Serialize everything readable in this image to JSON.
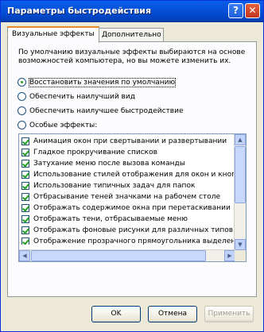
{
  "window": {
    "title": "Параметры быстродействия",
    "help_label": "?",
    "close_label": "✕"
  },
  "tabs": [
    {
      "label": "Визуальные эффекты"
    },
    {
      "label": "Дополнительно"
    }
  ],
  "panel": {
    "description": "По умолчанию визуальные эффекты выбираются на основе возможностей компьютера, но вы можете изменить их.",
    "radios": [
      {
        "label": "Восстановить значения по умолчанию",
        "selected": true
      },
      {
        "label": "Обеспечить наилучший вид",
        "selected": false
      },
      {
        "label": "Обеспечить наилучшее быстродействие",
        "selected": false
      },
      {
        "label": "Особые эффекты:",
        "selected": false
      }
    ],
    "effects": [
      {
        "label": "Анимация окон при свертывании и развертывании",
        "checked": true
      },
      {
        "label": "Гладкое прокручивание списков",
        "checked": true
      },
      {
        "label": "Затухание меню после вызова команды",
        "checked": true
      },
      {
        "label": "Использование стилей отображения для окон и кнопок",
        "checked": true
      },
      {
        "label": "Использование типичных задач для папок",
        "checked": true
      },
      {
        "label": "Отбрасывание теней значками на рабочем столе",
        "checked": true
      },
      {
        "label": "Отображать содержимое окна при перетаскивании",
        "checked": true
      },
      {
        "label": "Отображать тени, отбрасываемые меню",
        "checked": true
      },
      {
        "label": "Отображать фоновые рисунки для различных типов папок",
        "checked": true
      },
      {
        "label": "Отображение прозрачного прямоугольника выделения",
        "checked": true
      }
    ]
  },
  "buttons": {
    "ok": "OK",
    "cancel": "Отмена",
    "apply": "Применить"
  }
}
